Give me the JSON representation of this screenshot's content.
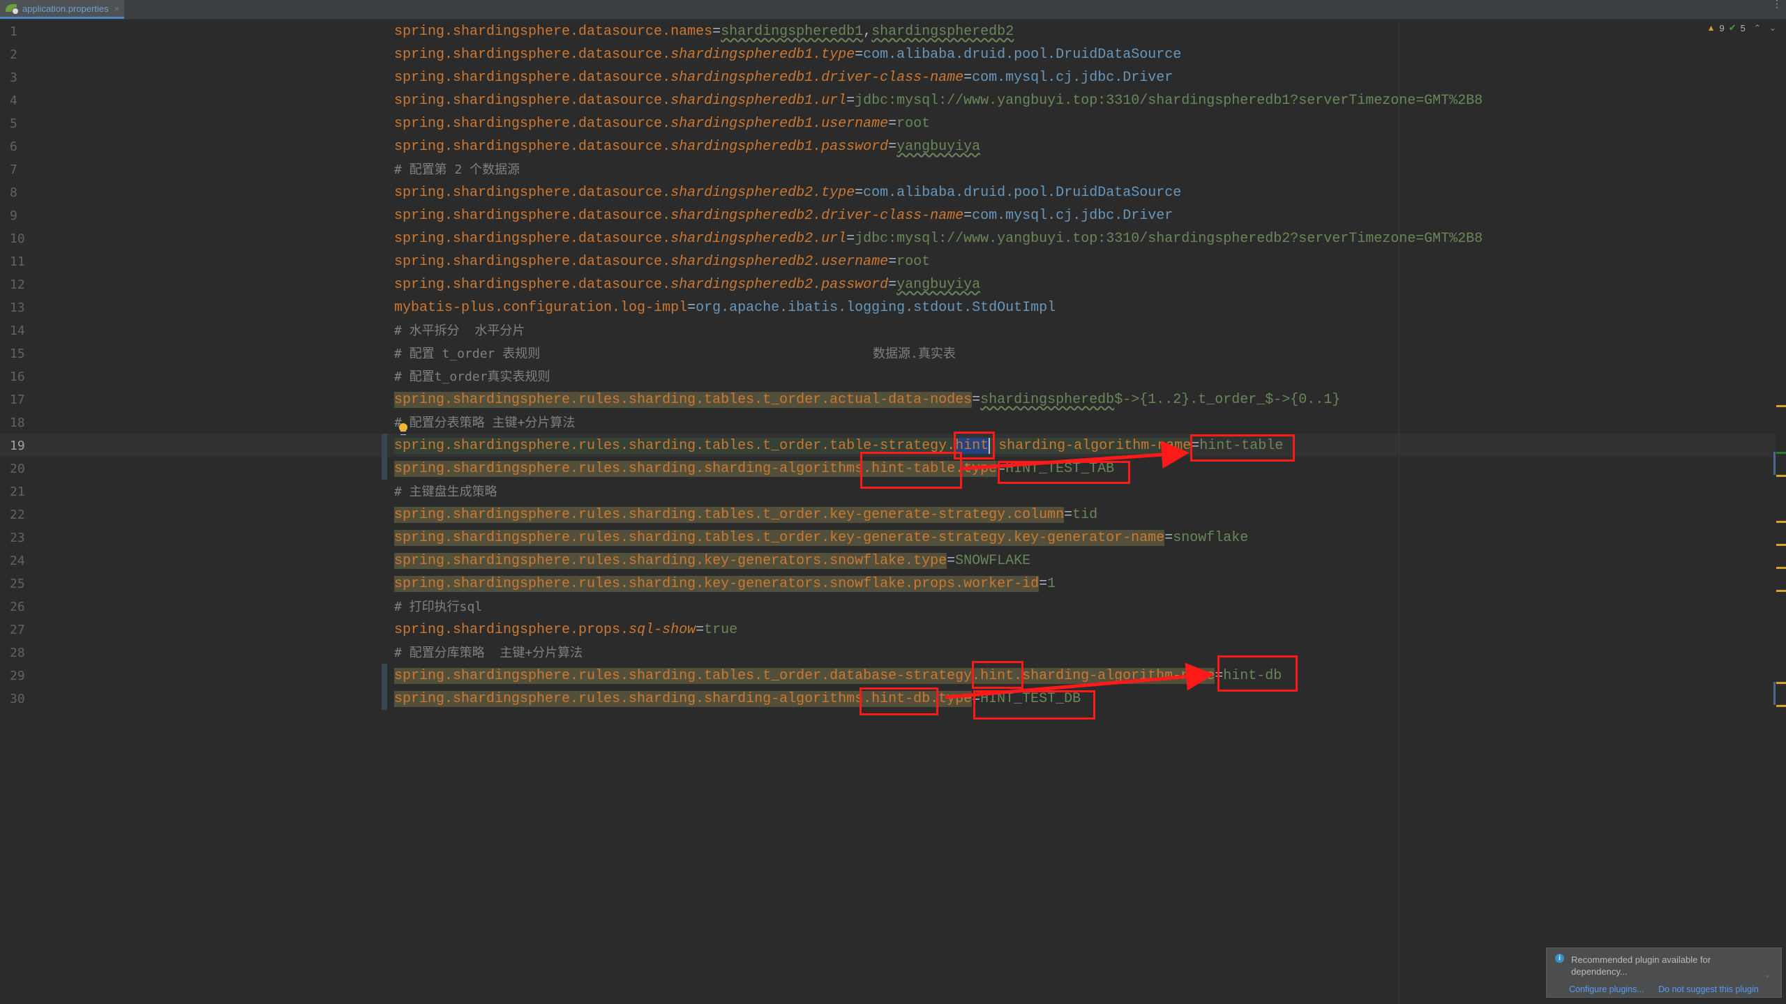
{
  "tab": {
    "label": "application.properties",
    "close": "×",
    "icon": "spring-boot-config-icon"
  },
  "inspections": {
    "warnings": "9",
    "typos": "5",
    "warn_icon": "▲",
    "check_icon": "✔",
    "up": "⌃",
    "down": "⌄"
  },
  "tabbar_menu": "⋮",
  "lines": [
    {
      "n": "1",
      "parts": [
        [
          "k",
          "spring.shardingsphere.datasource.names"
        ],
        [
          "eq",
          "="
        ],
        [
          "vu",
          "shardingspheredb1"
        ],
        [
          "eq",
          ","
        ],
        [
          "vu",
          "shardingspheredb2"
        ]
      ]
    },
    {
      "n": "2",
      "parts": [
        [
          "k",
          "spring.shardingsphere.datasource."
        ],
        [
          "ki",
          "shardingspheredb1.type"
        ],
        [
          "eq",
          "="
        ],
        [
          "vb",
          "com.alibaba.druid.pool.DruidDataSource"
        ]
      ]
    },
    {
      "n": "3",
      "parts": [
        [
          "k",
          "spring.shardingsphere.datasource."
        ],
        [
          "ki",
          "shardingspheredb1.driver-class-name"
        ],
        [
          "eq",
          "="
        ],
        [
          "vb",
          "com.mysql.cj.jdbc.Driver"
        ]
      ]
    },
    {
      "n": "4",
      "parts": [
        [
          "k",
          "spring.shardingsphere.datasource."
        ],
        [
          "ki",
          "shardingspheredb1.url"
        ],
        [
          "eq",
          "="
        ],
        [
          "v",
          "jdbc:mysql://www.yangbuyi.top:3310/shardingspheredb1?serverTimezone=GMT%2B8"
        ]
      ]
    },
    {
      "n": "5",
      "parts": [
        [
          "k",
          "spring.shardingsphere.datasource."
        ],
        [
          "ki",
          "shardingspheredb1.username"
        ],
        [
          "eq",
          "="
        ],
        [
          "v",
          "root"
        ]
      ]
    },
    {
      "n": "6",
      "parts": [
        [
          "k",
          "spring.shardingsphere.datasource."
        ],
        [
          "ki",
          "shardingspheredb1.password"
        ],
        [
          "eq",
          "="
        ],
        [
          "vu",
          "yangbuyiya"
        ]
      ]
    },
    {
      "n": "7",
      "parts": [
        [
          "c",
          "# 配置第 2 个数据源"
        ]
      ]
    },
    {
      "n": "8",
      "parts": [
        [
          "k",
          "spring.shardingsphere.datasource."
        ],
        [
          "ki",
          "shardingspheredb2.type"
        ],
        [
          "eq",
          "="
        ],
        [
          "vb",
          "com.alibaba.druid.pool.DruidDataSource"
        ]
      ]
    },
    {
      "n": "9",
      "parts": [
        [
          "k",
          "spring.shardingsphere.datasource."
        ],
        [
          "ki",
          "shardingspheredb2.driver-class-name"
        ],
        [
          "eq",
          "="
        ],
        [
          "vb",
          "com.mysql.cj.jdbc.Driver"
        ]
      ]
    },
    {
      "n": "10",
      "parts": [
        [
          "k",
          "spring.shardingsphere.datasource."
        ],
        [
          "ki",
          "shardingspheredb2.url"
        ],
        [
          "eq",
          "="
        ],
        [
          "v",
          "jdbc:mysql://www.yangbuyi.top:3310/shardingspheredb2?serverTimezone=GMT%2B8"
        ]
      ]
    },
    {
      "n": "11",
      "parts": [
        [
          "k",
          "spring.shardingsphere.datasource."
        ],
        [
          "ki",
          "shardingspheredb2.username"
        ],
        [
          "eq",
          "="
        ],
        [
          "v",
          "root"
        ]
      ]
    },
    {
      "n": "12",
      "parts": [
        [
          "k",
          "spring.shardingsphere.datasource."
        ],
        [
          "ki",
          "shardingspheredb2.password"
        ],
        [
          "eq",
          "="
        ],
        [
          "vu",
          "yangbuyiya"
        ]
      ]
    },
    {
      "n": "13",
      "parts": [
        [
          "k",
          "mybatis-plus.configuration.log-impl"
        ],
        [
          "eq",
          "="
        ],
        [
          "vb",
          "org.apache.ibatis.logging.stdout.StdOutImpl"
        ]
      ]
    },
    {
      "n": "14",
      "parts": [
        [
          "c",
          "# 水平拆分  水平分片"
        ]
      ]
    },
    {
      "n": "15",
      "parts": [
        [
          "c",
          "# 配置 t_order 表规则                                            数据源.真实表"
        ]
      ]
    },
    {
      "n": "16",
      "parts": [
        [
          "c",
          "# 配置t_order真实表规则"
        ]
      ]
    },
    {
      "n": "17",
      "parts": [
        [
          "khl",
          "spring.shardingsphere.rules.sharding.tables.t_order.actual-data-nodes"
        ],
        [
          "eq",
          "="
        ],
        [
          "vu",
          "shardingspheredb"
        ],
        [
          "v",
          "$->{1..2}.t_order_$->{0..1}"
        ]
      ]
    },
    {
      "n": "18",
      "parts": [
        [
          "c",
          "# 配置分表策略 主键+分片算法"
        ]
      ]
    },
    {
      "n": "19",
      "parts": [
        [
          "khl2",
          "spring.shardingsphere.rules.sharding.tables.t_order.table-strategy."
        ],
        [
          "ksel",
          "hint"
        ],
        [
          "khl2",
          ".sharding-algorithm-name"
        ],
        [
          "eq",
          "="
        ],
        [
          "v",
          "hint-table"
        ]
      ]
    },
    {
      "n": "20",
      "parts": [
        [
          "khl",
          "spring.shardingsphere.rules.sharding.sharding-algorithms.hint-table.type"
        ],
        [
          "eq",
          "="
        ],
        [
          "v",
          "HINT_TEST_TAB"
        ]
      ]
    },
    {
      "n": "21",
      "parts": [
        [
          "c",
          "# 主键盘生成策略"
        ]
      ]
    },
    {
      "n": "22",
      "parts": [
        [
          "khl",
          "spring.shardingsphere.rules.sharding.tables.t_order.key-generate-strategy.column"
        ],
        [
          "eq",
          "="
        ],
        [
          "v",
          "tid"
        ]
      ]
    },
    {
      "n": "23",
      "parts": [
        [
          "khl",
          "spring.shardingsphere.rules.sharding.tables.t_order.key-generate-strategy.key-generator-name"
        ],
        [
          "eq",
          "="
        ],
        [
          "v",
          "snowflake"
        ]
      ]
    },
    {
      "n": "24",
      "parts": [
        [
          "khl",
          "spring.shardingsphere.rules.sharding.key-generators.snowflake.type"
        ],
        [
          "eq",
          "="
        ],
        [
          "v",
          "SNOWFLAKE"
        ]
      ]
    },
    {
      "n": "25",
      "parts": [
        [
          "khl",
          "spring.shardingsphere.rules.sharding.key-generators.snowflake.props.worker-id"
        ],
        [
          "eq",
          "="
        ],
        [
          "v",
          "1"
        ]
      ]
    },
    {
      "n": "26",
      "parts": [
        [
          "c",
          "# 打印执行sql"
        ]
      ]
    },
    {
      "n": "27",
      "parts": [
        [
          "k",
          "spring.shardingsphere.props."
        ],
        [
          "ki",
          "sql-show"
        ],
        [
          "eq",
          "="
        ],
        [
          "v",
          "true"
        ]
      ]
    },
    {
      "n": "28",
      "parts": [
        [
          "c",
          "# 配置分库策略  主键+分片算法"
        ]
      ]
    },
    {
      "n": "29",
      "parts": [
        [
          "khl",
          "spring.shardingsphere.rules.sharding.tables.t_order.database-strategy.hint.sharding-algorithm-name"
        ],
        [
          "eq",
          "="
        ],
        [
          "v",
          "hint-db"
        ]
      ]
    },
    {
      "n": "30",
      "parts": [
        [
          "khl",
          "spring.shardingsphere.rules.sharding.sharding-algorithms.hint-db.type"
        ],
        [
          "eq",
          "="
        ],
        [
          "v",
          "HINT_TEST_DB"
        ]
      ]
    }
  ],
  "current_line": "19",
  "notification": {
    "icon": "i",
    "message": "Recommended plugin available for dependency...",
    "link_configure": "Configure plugins...",
    "link_dismiss": "Do not suggest this plugin",
    "chevron": "⌄"
  }
}
